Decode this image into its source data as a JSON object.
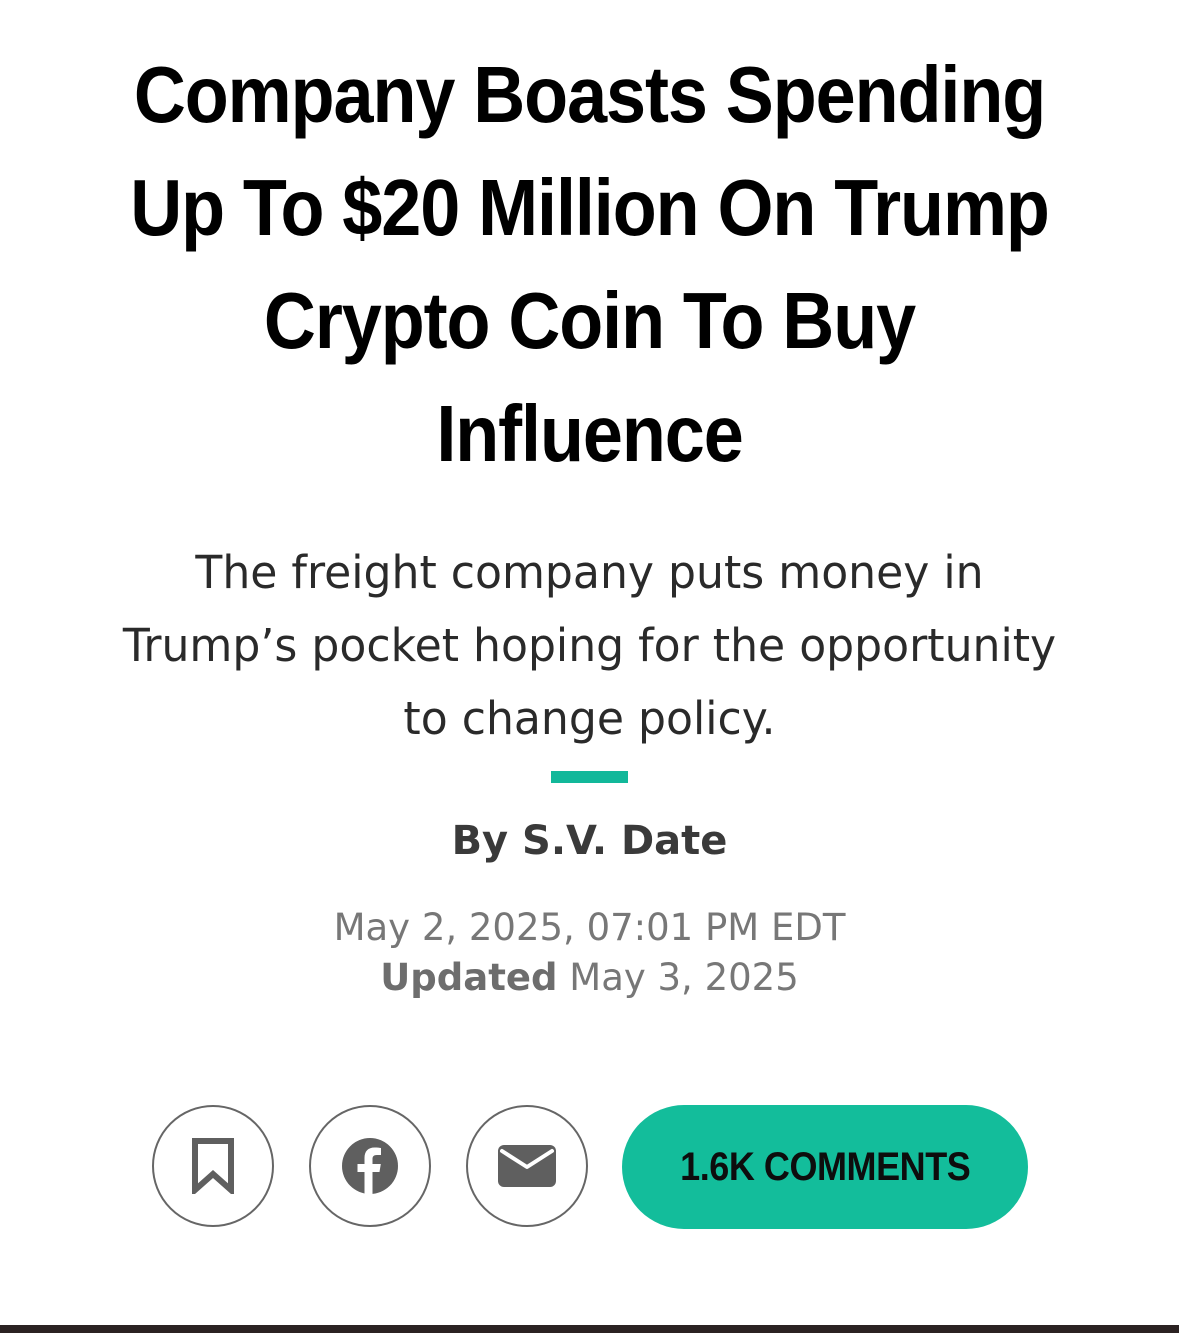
{
  "article": {
    "headline": "Company Boasts Spending Up To $20 Million On Trump Crypto Coin To Buy Influence",
    "dek": "The freight company puts money in Trump’s pocket hoping for the opportunity to change policy.",
    "byline": "By S.V. Date",
    "published": "May 2, 2025, 07:01 PM EDT",
    "updated_label": "Updated",
    "updated_date": "May 3, 2025"
  },
  "actions": {
    "bookmark_icon": "bookmark-icon",
    "facebook_icon": "facebook-icon",
    "email_icon": "email-icon",
    "comments_label": "1.6K COMMENTS"
  },
  "colors": {
    "accent": "#13bd9b",
    "headline": "#000000",
    "dek": "#2a2a2a",
    "byline": "#3a3a3a",
    "dates": "#777777",
    "icon": "#5f5f5f"
  }
}
